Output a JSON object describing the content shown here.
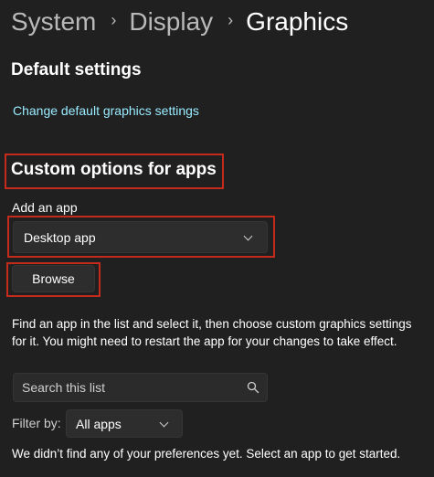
{
  "breadcrumb": {
    "items": [
      "System",
      "Display",
      "Graphics"
    ],
    "separator": "›"
  },
  "default_settings": {
    "title": "Default settings",
    "link": "Change default graphics settings"
  },
  "custom_options": {
    "title": "Custom options for apps",
    "add_app_label": "Add an app",
    "app_type_selected": "Desktop app",
    "browse_label": "Browse",
    "description": "Find an app in the list and select it, then choose custom graphics settings for it. You might need to restart the app for your changes to take effect.",
    "search_placeholder": "Search this list",
    "filter_label": "Filter by:",
    "filter_selected": "All apps",
    "empty_message": "We didn’t find any of your preferences yet. Select an app to get started."
  },
  "colors": {
    "background": "#202020",
    "link": "#99ebff",
    "highlight": "#c42b1c",
    "control": "#2d2d2d"
  },
  "icons": [
    "chevron-right-icon",
    "chevron-down-icon",
    "search-icon"
  ]
}
